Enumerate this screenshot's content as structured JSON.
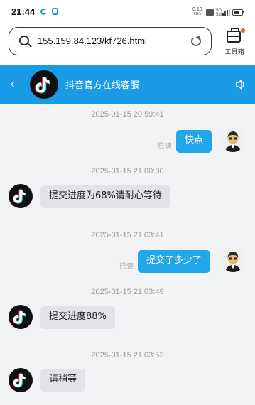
{
  "status_bar": {
    "time": "21:44",
    "net_speed": "0.10",
    "net_unit": "KB/s",
    "signal_label": "5G",
    "signal_sub": "5all"
  },
  "browser": {
    "url": "155.159.84.123/kf726.html",
    "toolbox_label": "工具箱"
  },
  "header": {
    "title": "抖音官方在线客服",
    "back_icon": "chevron-left-icon",
    "sound_icon": "speaker-icon"
  },
  "colors": {
    "header_bg": "#1a9be8",
    "outgoing_bubble": "#22a6ea",
    "incoming_bubble": "#e2e3e6",
    "chat_bg": "#f2f3f5"
  },
  "messages": [
    {
      "timestamp": "2025-01-15 20:59:41",
      "direction": "out",
      "text": "快点",
      "status": "已读"
    },
    {
      "timestamp": "2025-01-15 21:00:00",
      "direction": "in",
      "text": "提交进度为68%请耐心等待"
    },
    {
      "timestamp": "2025-01-15 21:03:41",
      "direction": "out",
      "text": "提交了多少了",
      "status": "已读"
    },
    {
      "timestamp": "2025-01-15 21:03:49",
      "direction": "in",
      "text": "提交进度88%"
    },
    {
      "timestamp": "2025-01-15 21:03:52",
      "direction": "in",
      "text": "请稍等"
    }
  ]
}
